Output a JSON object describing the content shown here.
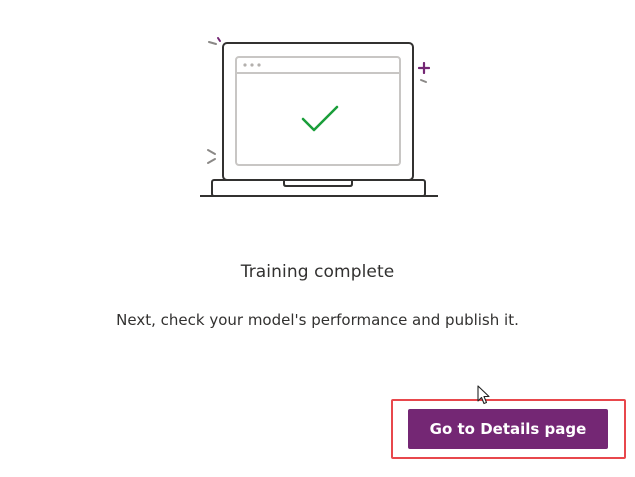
{
  "status": {
    "title": "Training complete",
    "message": "Next, check your model's performance and publish it."
  },
  "actions": {
    "primary_label": "Go to Details page"
  },
  "colors": {
    "brand_purple": "#742774",
    "success_green": "#1a9e3a",
    "highlight_red": "#e8474c",
    "line_dark": "#323130",
    "line_light": "#c8c6c4"
  },
  "icons": [
    "laptop-illustration",
    "checkmark-icon",
    "sparkle-icon",
    "cursor-icon"
  ]
}
